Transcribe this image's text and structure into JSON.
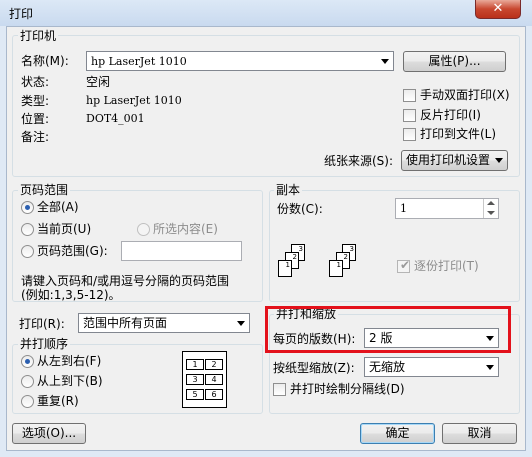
{
  "window": {
    "title": "打印",
    "close_glyph": "✕"
  },
  "printer": {
    "group_label": "打印机",
    "name_label": "名称(M):",
    "name_value": "hp LaserJet 1010",
    "properties_button": "属性(P)...",
    "status_label": "状态:",
    "status_value": "空闲",
    "type_label": "类型:",
    "type_value": "hp LaserJet 1010",
    "where_label": "位置:",
    "where_value": "DOT4_001",
    "comment_label": "备注:",
    "manual_duplex": {
      "label": "手动双面打印(X)",
      "checked": false
    },
    "mirror_print": {
      "label": "反片打印(I)",
      "checked": false
    },
    "print_to_file": {
      "label": "打印到文件(L)",
      "checked": false
    },
    "paper_source_label": "纸张来源(S):",
    "paper_source_value": "使用打印机设置"
  },
  "page_range": {
    "group_label": "页码范围",
    "all": {
      "label": "全部(A)",
      "selected": true
    },
    "current": {
      "label": "当前页(U)",
      "selected": false
    },
    "selection": {
      "label": "所选内容(E)",
      "selected": false,
      "disabled": true
    },
    "pages": {
      "label": "页码范围(G):",
      "selected": false,
      "value": ""
    },
    "hint": "请键入页码和/或用逗号分隔的页码范围(例如:1,3,5-12)。"
  },
  "copies": {
    "group_label": "副本",
    "count_label": "份数(C):",
    "count_value": "1",
    "collate": {
      "label": "逐份打印(T)",
      "checked": true,
      "disabled": true
    },
    "collate_icon": {
      "stack_a": [
        "1",
        "2",
        "3"
      ],
      "stack_b": [
        "1",
        "2",
        "3"
      ]
    }
  },
  "print_what": {
    "label": "打印(R):",
    "value": "范围中所有页面"
  },
  "page_order": {
    "group_label": "并打顺序",
    "left_to_right": {
      "label": "从左到右(F)",
      "selected": true
    },
    "top_to_bottom": {
      "label": "从上到下(B)",
      "selected": false
    },
    "repeat": {
      "label": "重复(R)",
      "selected": false
    },
    "preview_numbers": [
      "1",
      "2",
      "3",
      "4",
      "5",
      "6"
    ]
  },
  "zoom": {
    "group_label": "并打和缩放",
    "pages_per_sheet_label": "每页的版数(H):",
    "pages_per_sheet_value": "2 版",
    "scale_label": "按纸型缩放(Z):",
    "scale_value": "无缩放",
    "draw_borders": {
      "label": "并打时绘制分隔线(D)",
      "checked": false
    }
  },
  "footer": {
    "options_button": "选项(O)...",
    "ok_button": "确定",
    "cancel_button": "取消"
  },
  "colors": {
    "highlight_box": "#e3111b",
    "radio_dot": "#2b5fb0",
    "default_button_border": "#3c7fb1"
  }
}
